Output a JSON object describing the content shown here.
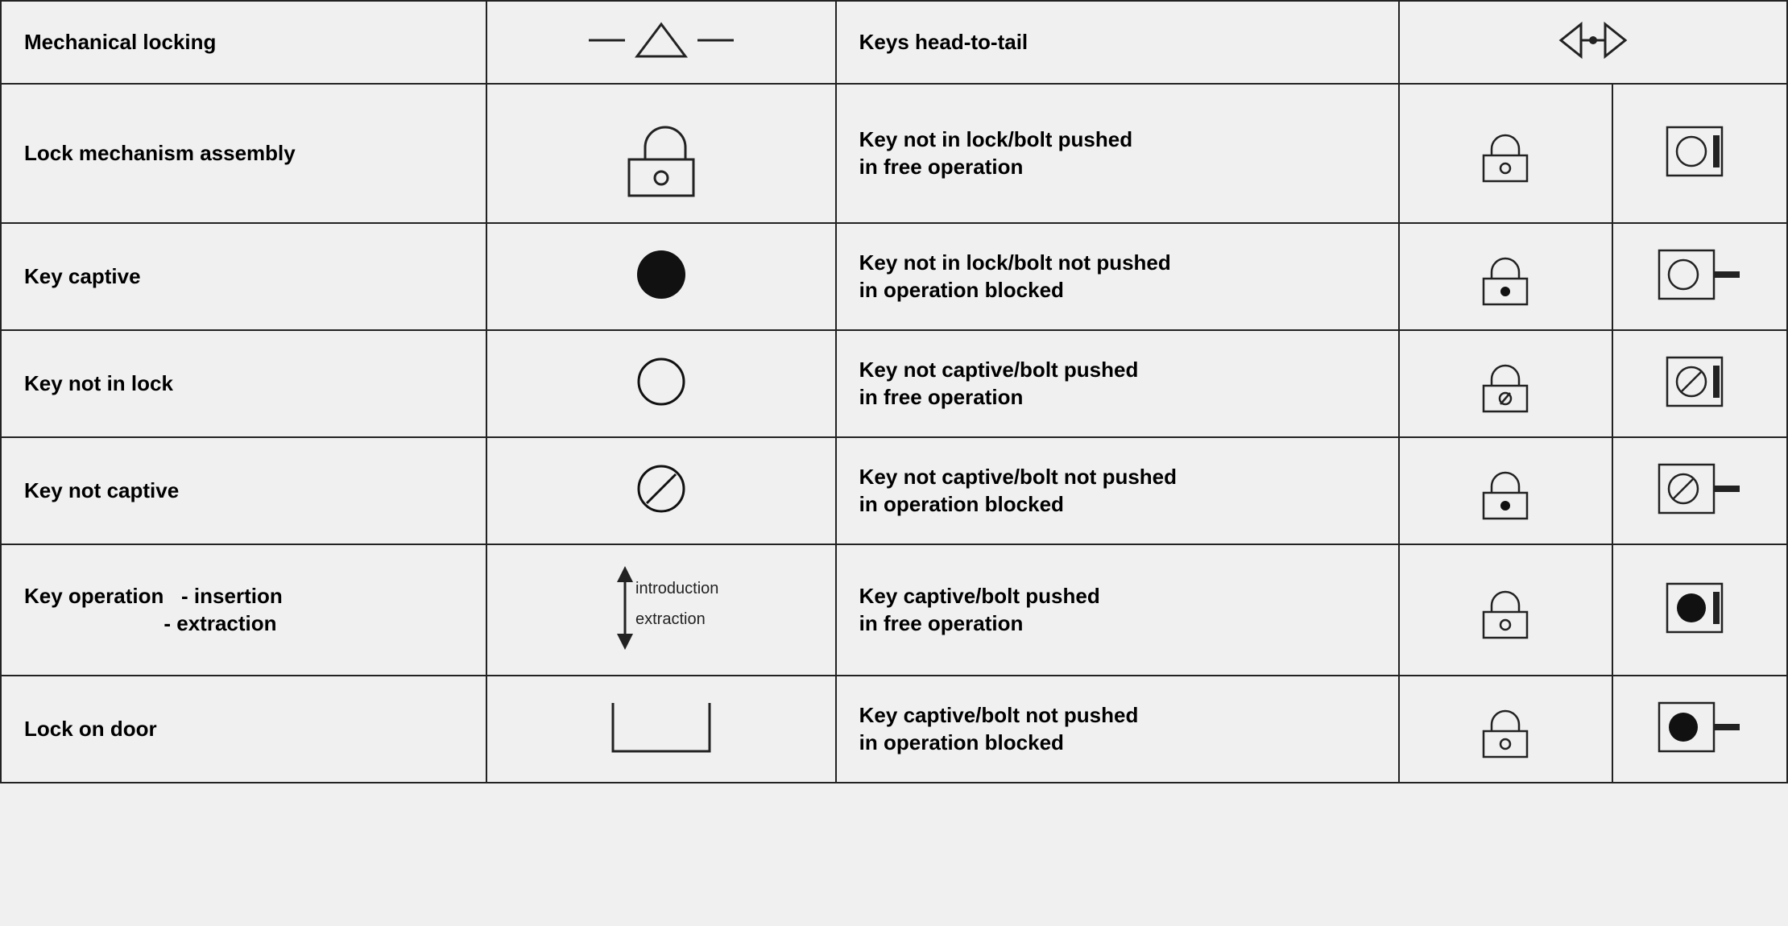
{
  "rows": [
    {
      "left_label": "Mechanical locking",
      "right_label": "Keys head-to-tail"
    },
    {
      "left_label": "Lock mechanism assembly",
      "right_label": "Key not in lock/bolt pushed\nin free operation"
    },
    {
      "left_label": "Key captive",
      "right_label": "Key not in lock/bolt not pushed\nin operation blocked"
    },
    {
      "left_label": "Key not in lock",
      "right_label": "Key not captive/bolt pushed\nin free operation"
    },
    {
      "left_label": "Key not captive",
      "right_label": "Key not captive/bolt not pushed\nin operation blocked"
    },
    {
      "left_label": "Key operation  - insertion\n             - extraction",
      "right_label": "Key captive/bolt pushed\nin free operation"
    },
    {
      "left_label": "Lock on door",
      "right_label": "Key captive/bolt not pushed\nin operation blocked"
    }
  ]
}
